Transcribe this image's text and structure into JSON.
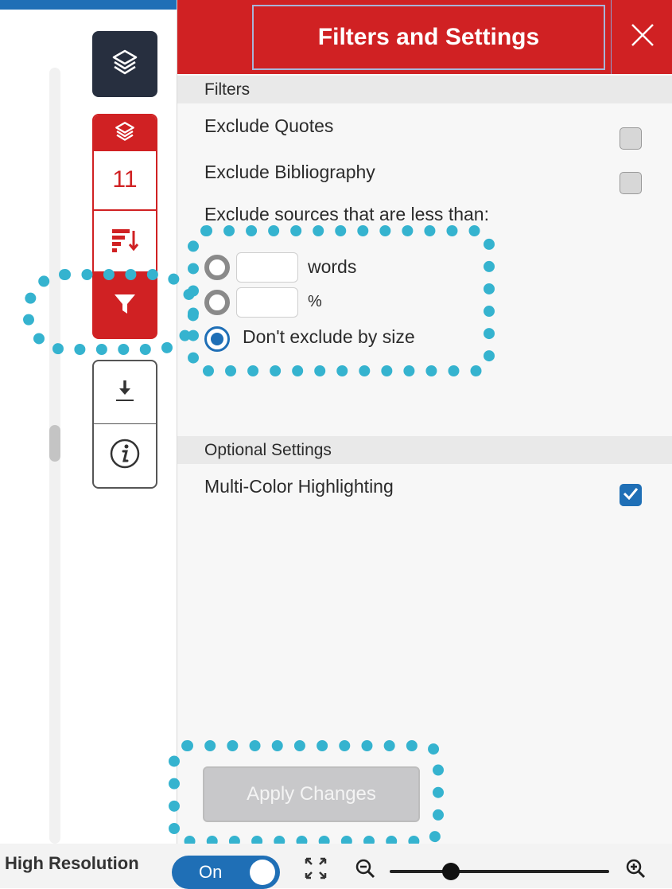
{
  "panel": {
    "title": "Filters and Settings",
    "filters_section": "Filters",
    "exclude_quotes": "Exclude Quotes",
    "exclude_bibliography": "Exclude Bibliography",
    "exclude_sources_label": "Exclude sources that are less than:",
    "words_unit": "words",
    "percent_unit": "%",
    "dont_exclude": "Don't exclude by size",
    "words_value": "",
    "percent_value": "",
    "optional_section": "Optional Settings",
    "multi_color": "Multi-Color Highlighting",
    "apply_button": "Apply Changes",
    "exclude_quotes_checked": false,
    "exclude_bibliography_checked": false,
    "multi_color_checked": true,
    "selected_size_option": "dont_exclude"
  },
  "toolbar": {
    "match_count": "11"
  },
  "bottom": {
    "high_resolution_label": "High Resolution",
    "toggle_state": "On",
    "zoom_level": 0.28
  },
  "colors": {
    "brand_red": "#d02123",
    "accent_blue": "#1f6fb6",
    "annotation_teal": "#35b3cf",
    "dark_navy": "#272f3f"
  }
}
